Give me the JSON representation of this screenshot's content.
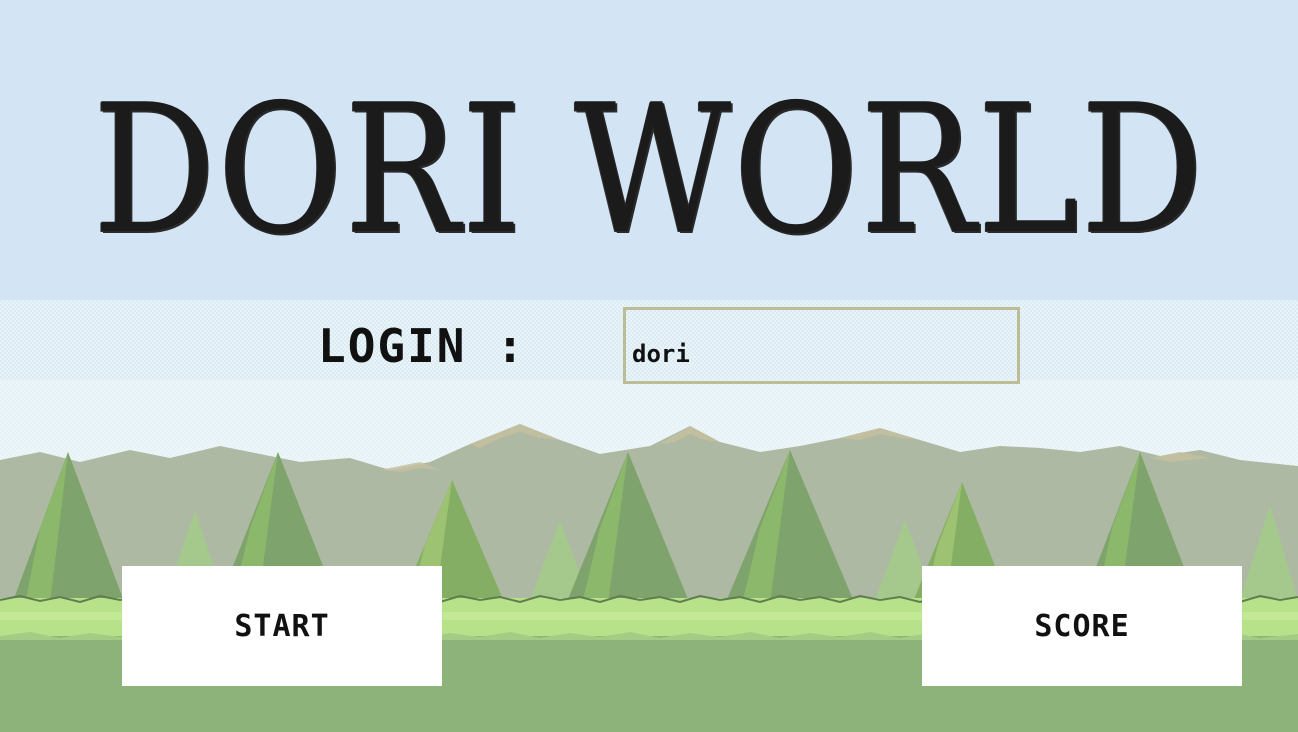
{
  "game": {
    "title": "DORI WORLD"
  },
  "login": {
    "label": "LOGIN :",
    "value": "dori"
  },
  "buttons": {
    "start_label": "START",
    "score_label": "SCORE"
  },
  "colors": {
    "sky_top": "#d3e5f5",
    "sky_haze": "#e8f3f7",
    "mountains": "#aeb9a3",
    "mountain_peaks": "#c4c0a0",
    "trees_dark": "#7aa06b",
    "trees_light": "#8fb86e",
    "grass_light": "#b7e28a",
    "ground": "#8db37a",
    "input_border": "#bcbc96"
  }
}
